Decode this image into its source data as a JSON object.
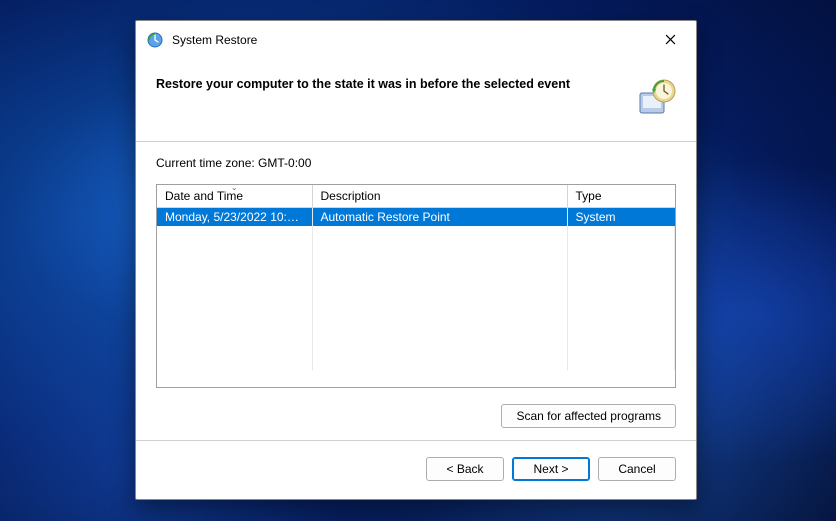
{
  "window": {
    "title": "System Restore"
  },
  "header": {
    "heading": "Restore your computer to the state it was in before the selected event"
  },
  "content": {
    "timezone_label": "Current time zone: GMT-0:00",
    "columns": {
      "date": "Date and Time",
      "description": "Description",
      "type": "Type"
    },
    "rows": [
      {
        "date": "Monday, 5/23/2022 10:11:...",
        "description": "Automatic Restore Point",
        "type": "System"
      }
    ],
    "scan_button": "Scan for affected programs"
  },
  "footer": {
    "back": "< Back",
    "next": "Next >",
    "cancel": "Cancel"
  }
}
